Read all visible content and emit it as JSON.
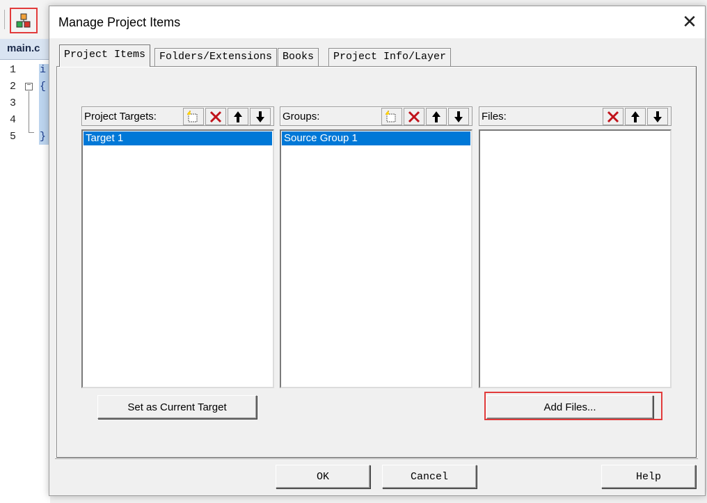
{
  "editor": {
    "file_tab": "main.c",
    "line_numbers": [
      "1",
      "2",
      "3",
      "4",
      "5"
    ],
    "code_lines": [
      "i",
      "{",
      "",
      "",
      "}"
    ],
    "fold_glyph": "−"
  },
  "dialog": {
    "title": "Manage Project Items",
    "close_glyph": "✕",
    "tabs": [
      {
        "label": "Project Items",
        "active": true
      },
      {
        "label": "Folders/Extensions",
        "active": false
      },
      {
        "label": "Books",
        "active": false
      },
      {
        "label": "Project Info/Layer",
        "active": false
      }
    ],
    "panes": {
      "targets": {
        "title": "Project Targets:",
        "icons": [
          "new-icon",
          "delete-icon",
          "move-up-icon",
          "move-down-icon"
        ],
        "items": [
          "Target 1"
        ],
        "selected": "Target 1"
      },
      "groups": {
        "title": "Groups:",
        "icons": [
          "new-icon",
          "delete-icon",
          "move-up-icon",
          "move-down-icon"
        ],
        "items": [
          "Source Group 1"
        ],
        "selected": "Source Group 1"
      },
      "files": {
        "title": "Files:",
        "icons": [
          "delete-icon",
          "move-up-icon",
          "move-down-icon"
        ],
        "items": []
      }
    },
    "set_current_target_label": "Set as Current Target",
    "add_files_label": "Add Files...",
    "ok_label": "OK",
    "cancel_label": "Cancel",
    "help_label": "Help"
  },
  "colors": {
    "selection": "#0078d7",
    "highlight_box": "#e23b3b",
    "delete_icon": "#c0121a"
  }
}
